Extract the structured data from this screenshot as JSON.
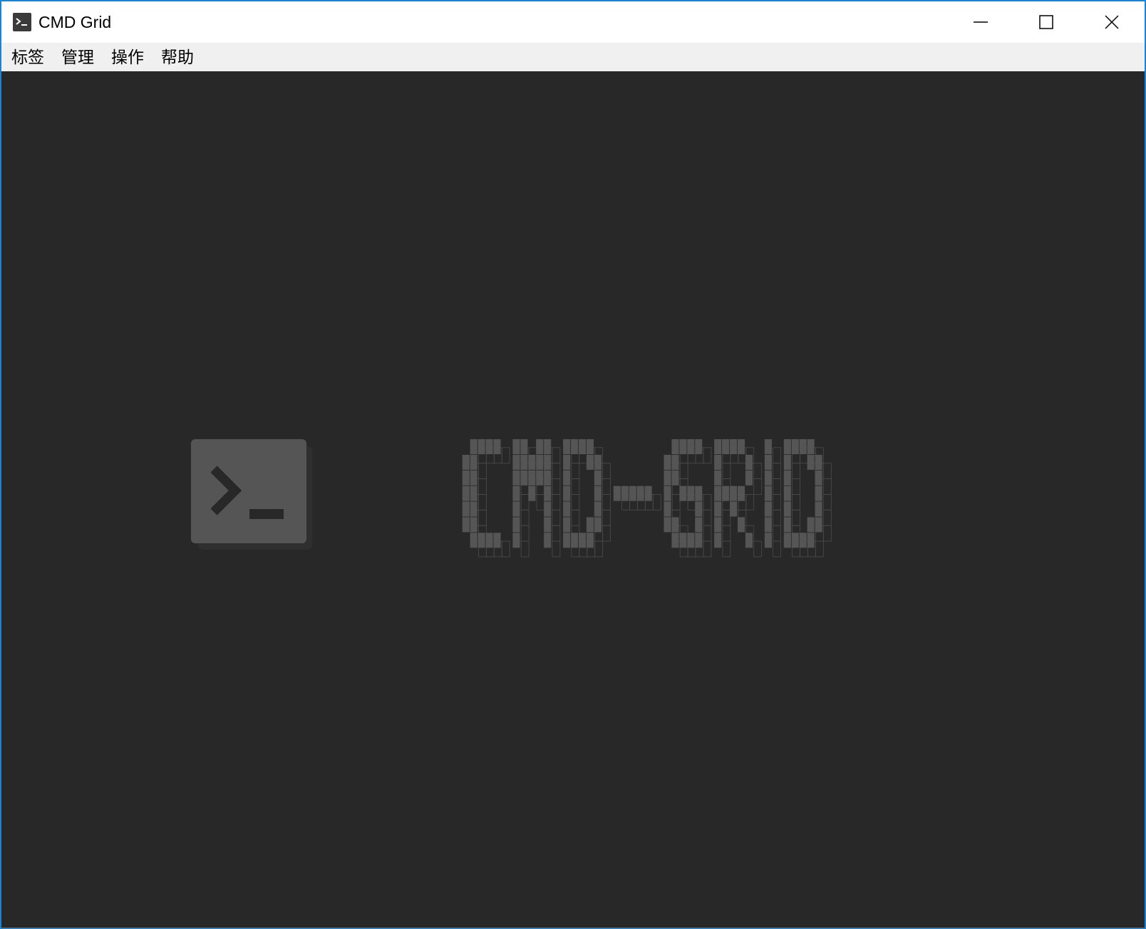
{
  "window": {
    "title": "CMD Grid",
    "app_icon": "terminal-prompt-icon",
    "controls": {
      "minimize": "minimize-icon",
      "maximize": "maximize-icon",
      "close": "close-icon"
    },
    "border_color": "#1883d7"
  },
  "menubar": {
    "items": [
      {
        "label": "标签"
      },
      {
        "label": "管理"
      },
      {
        "label": "操作"
      },
      {
        "label": "帮助"
      }
    ]
  },
  "content": {
    "background": "#282828",
    "logo": {
      "icon": "terminal-prompt-icon",
      "text": "CMD-GRID",
      "color": "#555555"
    }
  }
}
